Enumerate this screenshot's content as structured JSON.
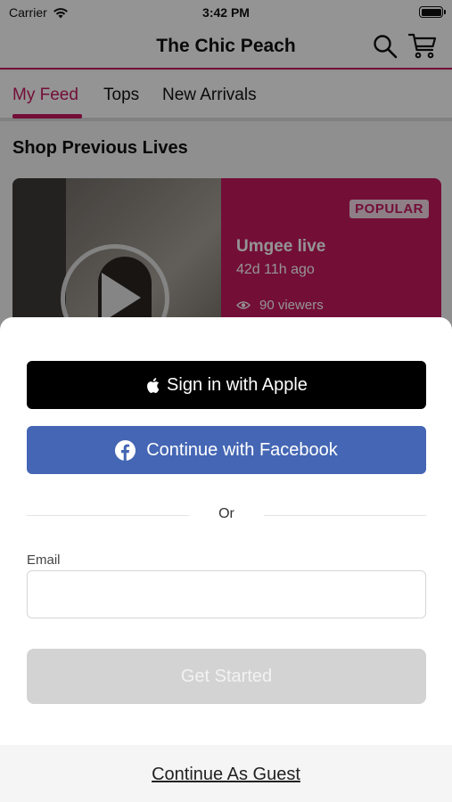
{
  "status_bar": {
    "carrier": "Carrier",
    "time": "3:42 PM"
  },
  "header": {
    "title": "The Chic Peach",
    "search_icon": "search-icon",
    "cart_icon": "cart-icon"
  },
  "tabs": [
    {
      "label": "My Feed",
      "active": true
    },
    {
      "label": "Tops",
      "active": false
    },
    {
      "label": "New Arrivals",
      "active": false
    }
  ],
  "section": {
    "title": "Shop Previous Lives"
  },
  "live_card": {
    "badge": "POPULAR",
    "name": "Umgee live",
    "ago": "42d 11h ago",
    "viewers": "90 viewers"
  },
  "sheet": {
    "apple_label": "Sign in with Apple",
    "facebook_label": "Continue with Facebook",
    "divider_text": "Or",
    "email_label": "Email",
    "email_value": "",
    "get_started_label": "Get Started",
    "guest_label": "Continue As Guest"
  },
  "colors": {
    "brand": "#c7195f",
    "facebook": "#4466b4",
    "apple": "#000000",
    "disabled": "#d3d3d3"
  }
}
